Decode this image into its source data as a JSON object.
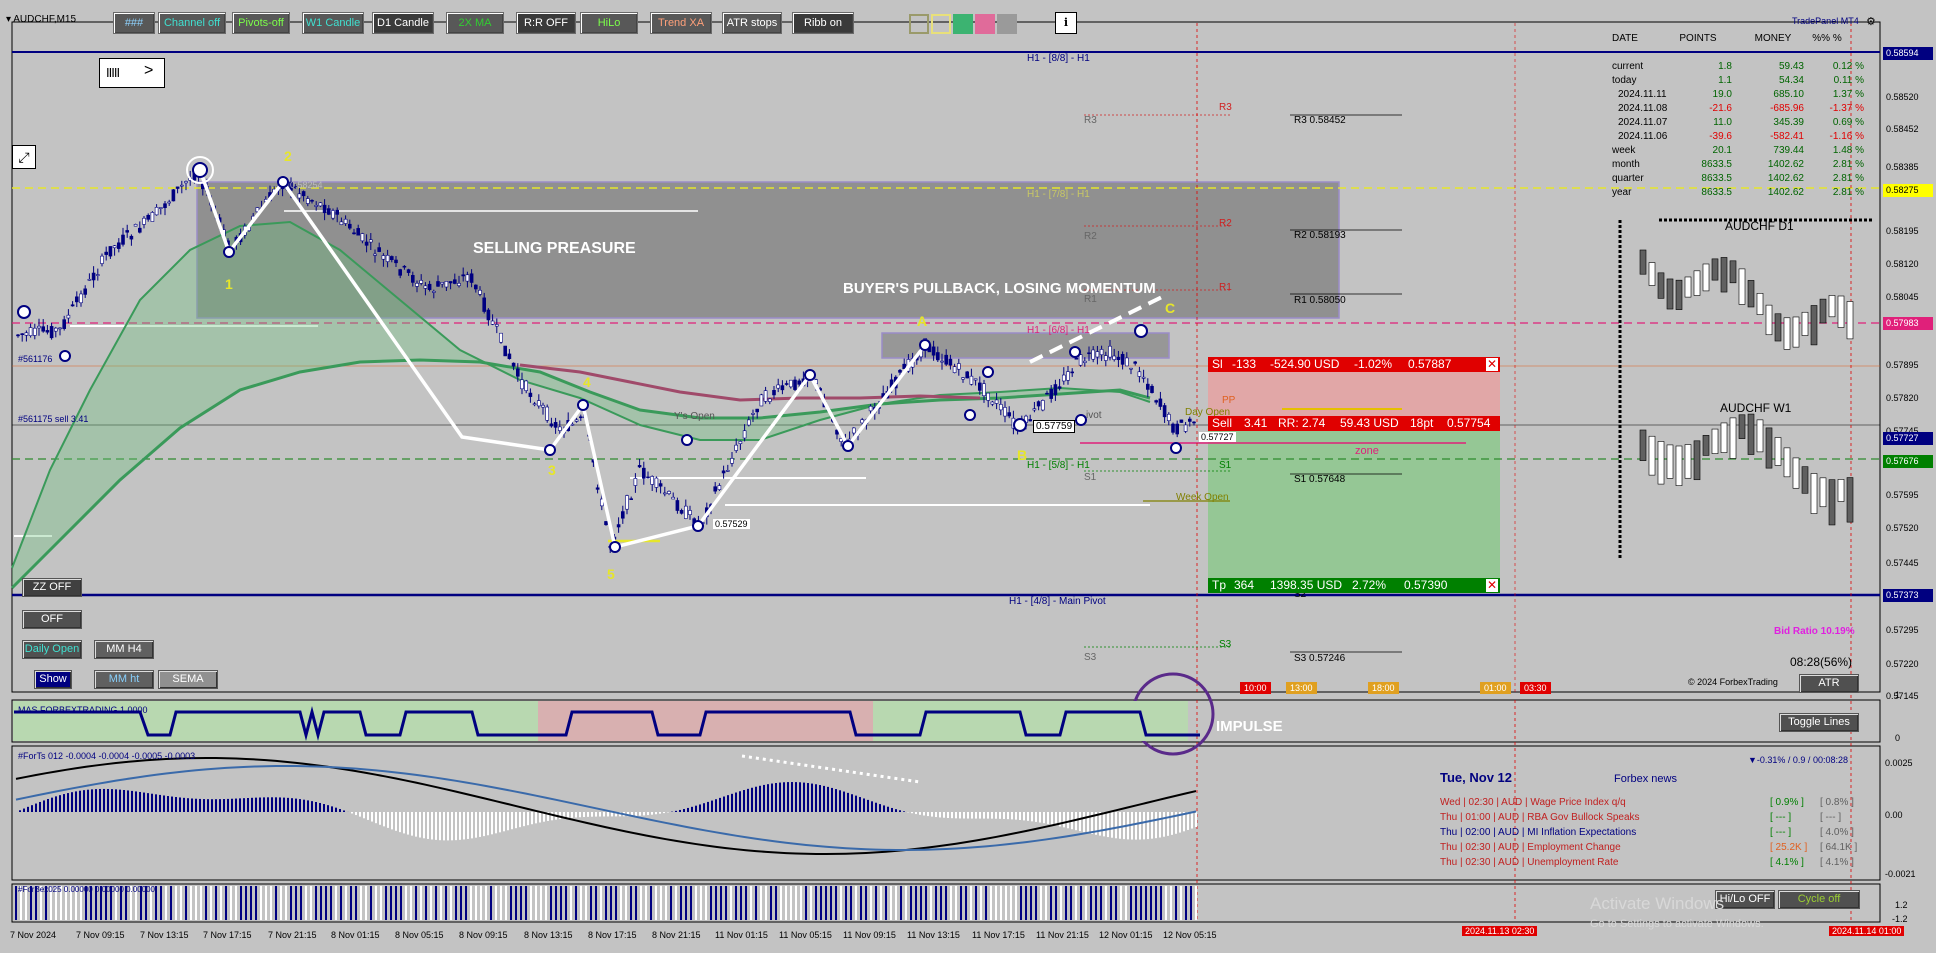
{
  "window": {
    "symbol": "AUDCHF,M15",
    "brand": "TradePanel MT4"
  },
  "toolbar": [
    {
      "label": "###",
      "bg": "#585858",
      "fg": "#8fd3ff"
    },
    {
      "label": "Channel off",
      "bg": "#585858",
      "fg": "#40e0d0"
    },
    {
      "label": "Pivots-off",
      "bg": "#585858",
      "fg": "#7cff4a"
    },
    {
      "label": "W1 Candle",
      "bg": "#585858",
      "fg": "#40e0d0"
    },
    {
      "label": "D1 Candle",
      "bg": "#3a3a3a",
      "fg": "#ffffff"
    },
    {
      "label": "2X MA",
      "bg": "#585858",
      "fg": "#32cd32"
    },
    {
      "label": "R:R OFF",
      "bg": "#3a3a3a",
      "fg": "#ffffff"
    },
    {
      "label": "HiLo",
      "bg": "#585858",
      "fg": "#7cff4a"
    },
    {
      "label": "Trend XA",
      "bg": "#585858",
      "fg": "#ffa07a"
    },
    {
      "label": "ATR stops",
      "bg": "#585858",
      "fg": "#ffffff"
    },
    {
      "label": "Ribb on",
      "bg": "#3a3a3a",
      "fg": "#ffffff"
    }
  ],
  "swatches": [
    "#9a9a6a",
    "#e8e07a",
    "#3cb371",
    "#e06b9a",
    "#9a9a9a"
  ],
  "info_button": "i",
  "nav_control": {
    "bars": "IIIII",
    "arrow": ">"
  },
  "left_buttons": {
    "zz": "ZZ OFF",
    "off": "OFF",
    "daily_open": "Daily Open",
    "mm_h4": "MM H4",
    "show": "Show",
    "mm_ht": "MM ht",
    "sema": "SEMA"
  },
  "annotations": {
    "selling": "SELLING PREASURE",
    "buyers": "BUYER'S PULLBACK, LOSING MOMENTUM",
    "impulse": "IMPULSE",
    "zone": "zone",
    "waves": [
      "1",
      "2",
      "3",
      "4",
      "5"
    ],
    "abc": [
      "A",
      "B",
      "C"
    ]
  },
  "chart_text": {
    "order_line": "#561176",
    "order_sell": "#561175 sell 3.41",
    "ys_open": "Y's Open",
    "daily_open": "Day Open",
    "week_open": "Week Open",
    "pivot": "ivot",
    "price_tag_5": "0.57529",
    "price_tag_b": "0.57759",
    "price_tag_c": "0.57727",
    "price_tag_top": "0.58254",
    "pp": "PP"
  },
  "murray": {
    "h1_88": "H1 - [8/8] - H1",
    "h1_78": "H1 - [7/8] - H1",
    "h1_68": "H1 - [6/8] - H1",
    "h1_58": "H1 - [5/8] - H1",
    "h1_48": "H1 - [4/8] - Main Pivot"
  },
  "pivots": {
    "r3": "R3",
    "r2": "R2",
    "r1": "R1",
    "s1": "S1",
    "s2": "S2",
    "s3": "S3",
    "r3v": "R3 0.58452",
    "r2v": "R2 0.58193",
    "r1v": "R1 0.58050",
    "s1v": "S1 0.57648",
    "s3v": "S3 0.57246"
  },
  "trade": {
    "sl": [
      "Sl",
      "-133",
      "-524.90 USD",
      "-1.02%",
      "0.57887"
    ],
    "entry": [
      "Sell",
      "3.41",
      "RR: 2.74",
      "59.43 USD",
      "18pt",
      "0.57754"
    ],
    "tp": [
      "Tp",
      "364",
      "1398.35 USD",
      "2.72%",
      "0.57390"
    ],
    "close": "✕"
  },
  "stats": {
    "headers": [
      "DATE",
      "POINTS",
      "MONEY",
      "%% %"
    ],
    "rows": [
      [
        "current",
        "1.8",
        "59.43",
        "0.12 %"
      ],
      [
        "today",
        "1.1",
        "54.34",
        "0.11 %"
      ],
      [
        "2024.11.11",
        "19.0",
        "685.10",
        "1.37 %"
      ],
      [
        "2024.11.08",
        "-21.6",
        "-685.96",
        "-1.37 %"
      ],
      [
        "2024.11.07",
        "11.0",
        "345.39",
        "0.69 %"
      ],
      [
        "2024.11.06",
        "-39.6",
        "-582.41",
        "-1.16 %"
      ],
      [
        "week",
        "20.1",
        "739.44",
        "1.48 %"
      ],
      [
        "month",
        "8633.5",
        "1402.62",
        "2.81 %"
      ],
      [
        "quarter",
        "8633.5",
        "1402.62",
        "2.81 %"
      ],
      [
        "year",
        "8633.5",
        "1402.62",
        "2.81 %"
      ]
    ]
  },
  "mini_charts": {
    "d1": "AUDCHF D1",
    "w1": "AUDCHF W1"
  },
  "right_info": {
    "bid_ratio": "Bid Ratio 10.19%",
    "timer": "08:28(56%)",
    "copyright": "© 2024 ForbexTrading",
    "atr": "ATR",
    "toggle": "Toggle Lines",
    "session": "▼-0.31% / 0.9 / 00:08:28",
    "hilo": "Hi/Lo OFF",
    "cycle": "Cycle off",
    "activate1": "Activate Windows",
    "activate2": "Go to Settings to activate Windows."
  },
  "sessions": [
    "10:00",
    "13:00",
    "18:00",
    "01:00",
    "03:30"
  ],
  "news": {
    "date": "Tue, Nov 12",
    "source": "Forbex news",
    "items": [
      {
        "text": "Wed | 02:30 | AUD | Wage Price Index q/q",
        "a": "[ 0.9% ]",
        "b": "[ 0.8% ]"
      },
      {
        "text": "Thu | 01:00 | AUD | RBA Gov Bullock Speaks",
        "a": "[ --- ]",
        "b": "[ --- ]"
      },
      {
        "text": "Thu | 02:00 | AUD | MI Inflation Expectations",
        "a": "[ --- ]",
        "b": "[ 4.0% ]"
      },
      {
        "text": "Thu | 02:30 | AUD | Employment Change",
        "a": "[ 25.2K ]",
        "b": "[ 64.1K ]"
      },
      {
        "text": "Thu | 02:30 | AUD | Unemployment Rate",
        "a": "[ 4.1% ]",
        "b": "[ 4.1% ]"
      }
    ]
  },
  "indicators": {
    "ind1": "MAS FORBEXTRADING 1.0000",
    "ind2": "#ForTs 012 -0.0004 -0.0004 -0.0005 -0.0003",
    "ind3": "#ForBex025 0.00000 0.00000 0.00000",
    "ind1_scale": [
      "1",
      "0"
    ],
    "ind2_scale": [
      "0.0025",
      "0.00",
      "-0.0021"
    ],
    "ind3_scale": [
      "1.2",
      "-1.2"
    ]
  },
  "price_axis": [
    {
      "v": "0.58594",
      "bg": "#000080",
      "fg": "#ffffff"
    },
    {
      "v": "0.58520",
      "bg": "",
      "fg": "#000000"
    },
    {
      "v": "0.58452",
      "bg": "",
      "fg": "#000000"
    },
    {
      "v": "0.58385",
      "bg": "",
      "fg": "#000000"
    },
    {
      "v": "0.58275",
      "bg": "#ffff00",
      "fg": "#000000"
    },
    {
      "v": "0.58195",
      "bg": "",
      "fg": "#000000"
    },
    {
      "v": "0.58120",
      "bg": "",
      "fg": "#000000"
    },
    {
      "v": "0.58045",
      "bg": "",
      "fg": "#000000"
    },
    {
      "v": "0.57983",
      "bg": "#e0207a",
      "fg": "#ffffff"
    },
    {
      "v": "0.57895",
      "bg": "",
      "fg": "#000000"
    },
    {
      "v": "0.57820",
      "bg": "",
      "fg": "#000000"
    },
    {
      "v": "0.57745",
      "bg": "",
      "fg": "#000000"
    },
    {
      "v": "0.57727",
      "bg": "#000080",
      "fg": "#ffffff"
    },
    {
      "v": "0.57676",
      "bg": "#008000",
      "fg": "#ffffff"
    },
    {
      "v": "0.57595",
      "bg": "",
      "fg": "#000000"
    },
    {
      "v": "0.57520",
      "bg": "",
      "fg": "#000000"
    },
    {
      "v": "0.57445",
      "bg": "",
      "fg": "#000000"
    },
    {
      "v": "0.57373",
      "bg": "#000080",
      "fg": "#ffffff"
    },
    {
      "v": "0.57295",
      "bg": "",
      "fg": "#000000"
    },
    {
      "v": "0.57220",
      "bg": "",
      "fg": "#000000"
    },
    {
      "v": "0.57145",
      "bg": "",
      "fg": "#000000"
    }
  ],
  "time_axis": [
    "7 Nov 2024",
    "7 Nov 09:15",
    "7 Nov 13:15",
    "7 Nov 17:15",
    "7 Nov 21:15",
    "8 Nov 01:15",
    "8 Nov 05:15",
    "8 Nov 09:15",
    "8 Nov 13:15",
    "8 Nov 17:15",
    "8 Nov 21:15",
    "11 Nov 01:15",
    "11 Nov 05:15",
    "11 Nov 09:15",
    "11 Nov 13:15",
    "11 Nov 17:15",
    "11 Nov 21:15",
    "12 Nov 01:15",
    "12 Nov 05:15"
  ],
  "time_markers": [
    "2024.11.13 02:30",
    "2024.11.14 01:00"
  ]
}
